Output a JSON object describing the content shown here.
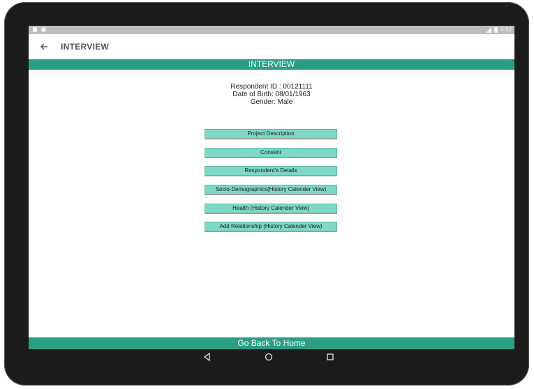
{
  "status_bar": {
    "time": "4:52"
  },
  "app_bar": {
    "title": "INTERVIEW"
  },
  "section_header": "INTERVIEW",
  "respondent": {
    "id_line": "Respondent ID : 00121111",
    "dob_line": "Date of Birth: 08/01/1963",
    "gender_line": "Gender: Male"
  },
  "menu": [
    {
      "label": "Project Description"
    },
    {
      "label": "Consent"
    },
    {
      "label": "Respondent's Details"
    },
    {
      "label": "Socio-Demographics(History Calender View)"
    },
    {
      "label": "Health (History Calender View)"
    },
    {
      "label": "Add Relationship (History Calender View)"
    }
  ],
  "footer_button": "Go Back To Home",
  "colors": {
    "primary": "#2a9e85",
    "button": "#7dd8c5"
  },
  "icons": [
    "back-arrow-icon",
    "nav-back-icon",
    "nav-home-icon",
    "nav-recents-icon"
  ]
}
